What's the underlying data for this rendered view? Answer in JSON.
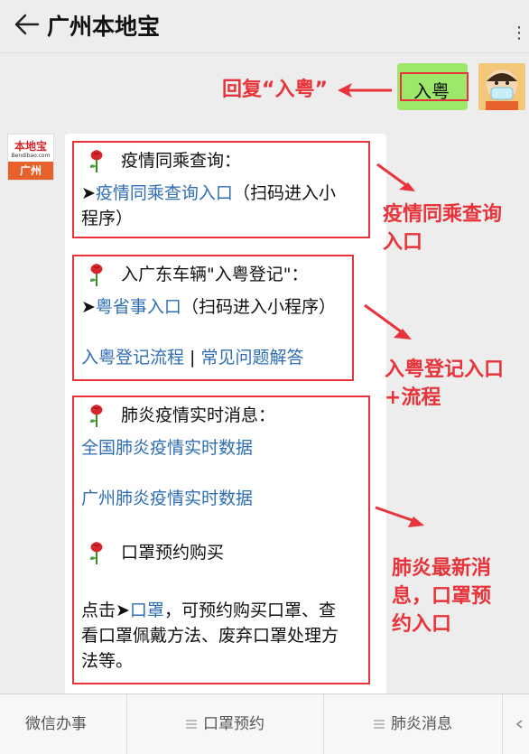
{
  "header": {
    "title": "广州本地宝",
    "more": "⋮"
  },
  "outgoing": {
    "text": "入粤"
  },
  "annotations": {
    "reply": "回复“入粤”",
    "section1": [
      "疫情同乘查询",
      "入口"
    ],
    "section2": [
      "入粤登记入口",
      "+流程"
    ],
    "section3": [
      "肺炎最新消",
      "息，口罩预",
      "约入口"
    ]
  },
  "bot": {
    "logo_text": "本地宝",
    "logo_sub": "Bendibao.com",
    "logo_city": "广州"
  },
  "card": {
    "s1": {
      "heading": "疫情同乘查询：",
      "arrow": "➤",
      "link": "疫情同乘查询入口",
      "note_1": "（扫码进入小",
      "note_2": "程序）"
    },
    "s2": {
      "heading": "入广东车辆\"入粤登记\"：",
      "arrow": "➤",
      "link": "粤省事入口",
      "note": "（扫码进入小程序）",
      "link2": "入粤登记流程",
      "sep": " | ",
      "link3": "常见问题解答"
    },
    "s3": {
      "heading": "肺炎疫情实时消息：",
      "link1": "全国肺炎疫情实时数据",
      "link2": "广州肺炎疫情实时数据",
      "heading2": "口罩预约购买",
      "p_prefix": "点击➤",
      "p_link": "口罩",
      "p_rest1": "，可预约购买口罩、查",
      "p_rest2": "看口罩佩戴方法、废弃口罩处理方",
      "p_rest3": "法等。"
    }
  },
  "menu": {
    "item1": "微信办事",
    "item2": "口罩预约",
    "item3": "肺炎消息"
  },
  "colors": {
    "annotation_red": "#e8333a",
    "link_blue": "#2f6eb5",
    "bubble_green": "#9de86a"
  }
}
